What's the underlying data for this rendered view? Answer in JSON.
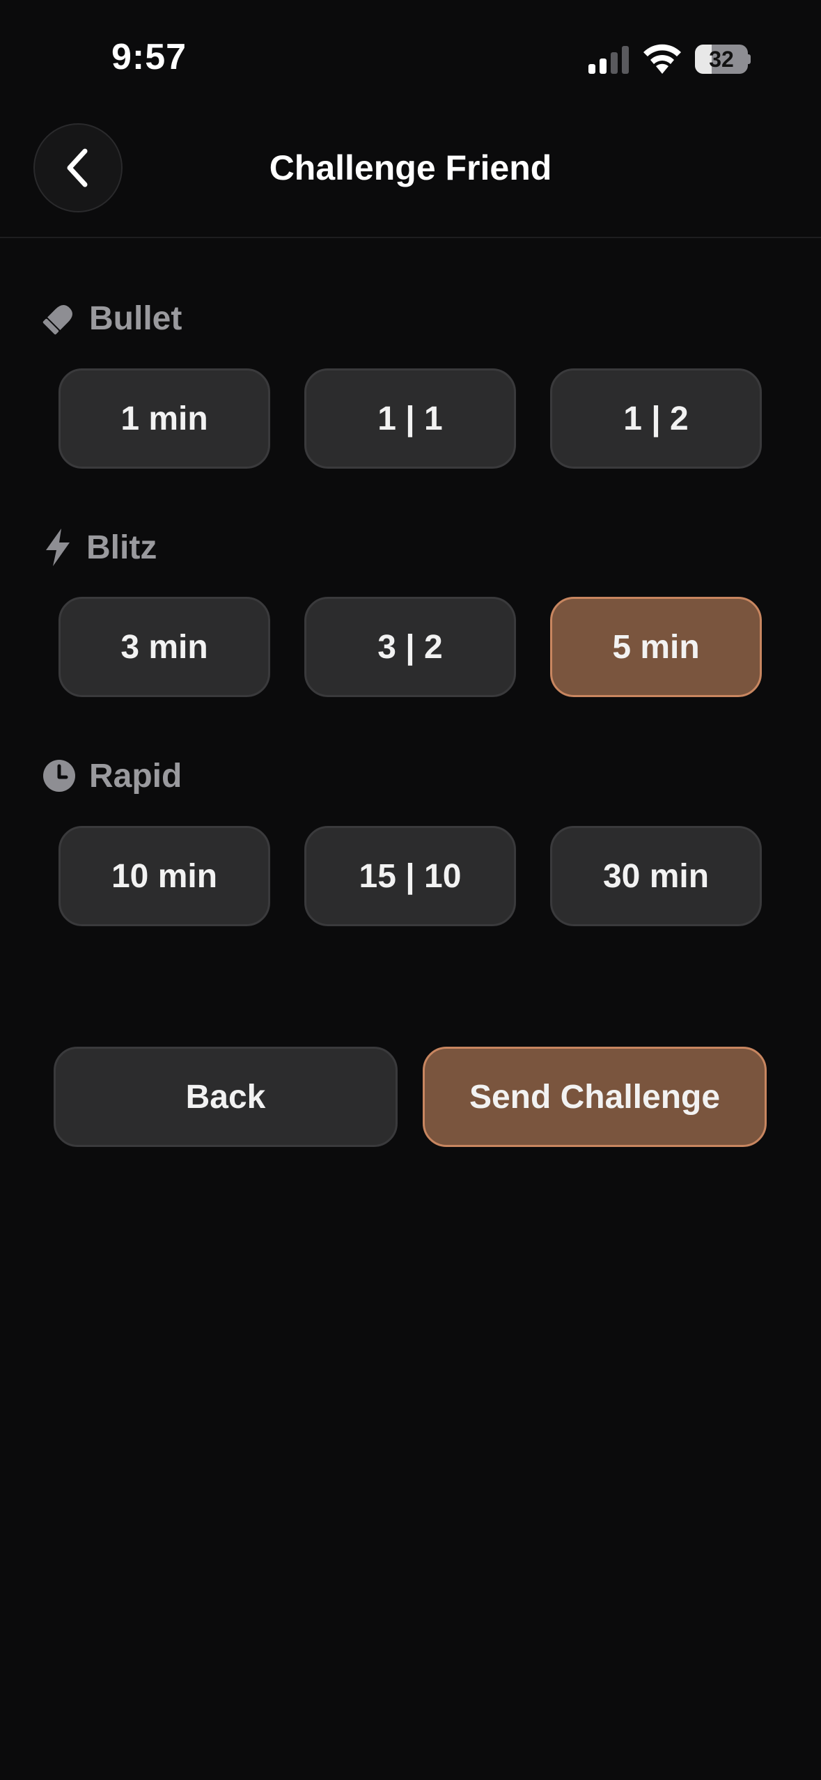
{
  "status_bar": {
    "time": "9:57",
    "battery_level": "32",
    "battery_fraction": 0.32,
    "signal_bars_active": 2,
    "signal_bars_total": 4
  },
  "header": {
    "title": "Challenge Friend",
    "back_icon": "chevron-left-icon"
  },
  "sections": [
    {
      "label": "Bullet",
      "icon": "bullet-icon",
      "options": [
        {
          "label": "1 min",
          "selected": false
        },
        {
          "label": "1 | 1",
          "selected": false
        },
        {
          "label": "1 | 2",
          "selected": false
        }
      ]
    },
    {
      "label": "Blitz",
      "icon": "lightning-icon",
      "options": [
        {
          "label": "3 min",
          "selected": false
        },
        {
          "label": "3 | 2",
          "selected": false
        },
        {
          "label": "5 min",
          "selected": true
        }
      ]
    },
    {
      "label": "Rapid",
      "icon": "clock-icon",
      "options": [
        {
          "label": "10 min",
          "selected": false
        },
        {
          "label": "15 | 10",
          "selected": false
        },
        {
          "label": "30 min",
          "selected": false
        }
      ]
    }
  ],
  "actions": {
    "back_label": "Back",
    "send_label": "Send Challenge"
  },
  "colors": {
    "background": "#0b0b0c",
    "option_bg": "#2c2c2d",
    "accent": "#7a553e",
    "accent_border": "#c88660",
    "section_label": "#9a9a9e"
  }
}
